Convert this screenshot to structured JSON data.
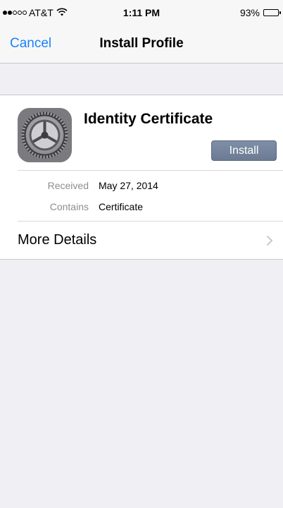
{
  "status_bar": {
    "carrier": "AT&T",
    "signal_icon": "signal-dots-icon",
    "wifi_icon": "wifi-icon",
    "time": "1:11 PM",
    "battery_percent": "93%",
    "battery_level": 0.93,
    "battery_icon": "battery-icon"
  },
  "nav": {
    "cancel_label": "Cancel",
    "title": "Install Profile"
  },
  "profile": {
    "icon": "settings-gear-icon",
    "name": "Identity Certificate",
    "install_label": "Install"
  },
  "details": {
    "received_label": "Received",
    "received_value": "May 27, 2014",
    "contains_label": "Contains",
    "contains_value": "Certificate"
  },
  "more_details": {
    "label": "More Details",
    "chevron_icon": "chevron-right-icon"
  },
  "colors": {
    "accent": "#1a82fb",
    "install_button": "#7585a0",
    "background": "#efeff4"
  }
}
